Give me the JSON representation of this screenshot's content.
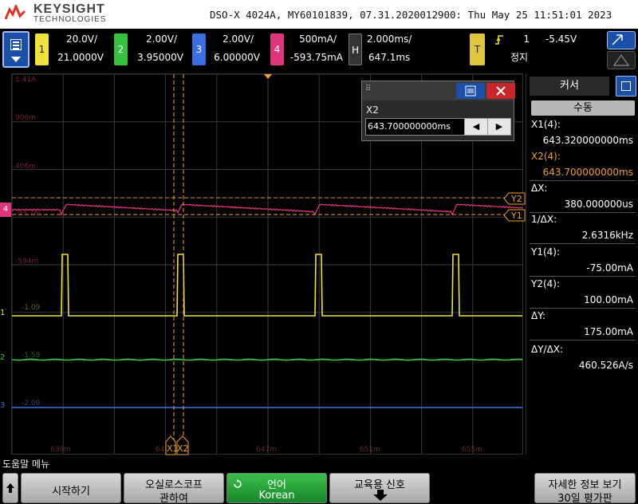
{
  "header": {
    "brand": "KEYSIGHT",
    "brand_sub": "TECHNOLOGIES",
    "title": "DSO-X 4024A, MY60101839, 07.31.2020012900: Thu May 25 11:51:01 2023"
  },
  "channels": [
    {
      "num": "1",
      "scale": "20.0V/",
      "offset": "21.0000V",
      "color": "#f0e23a"
    },
    {
      "num": "2",
      "scale": "2.00V/",
      "offset": "3.95000V",
      "color": "#36c43f"
    },
    {
      "num": "3",
      "scale": "2.00V/",
      "offset": "6.00000V",
      "color": "#3a6fe0"
    },
    {
      "num": "4",
      "scale": "500mA/",
      "offset": "-593.75mA",
      "color": "#e0357b"
    }
  ],
  "horizontal": {
    "tag": "H",
    "scale": "2.000ms/",
    "position": "647.1ms"
  },
  "trigger": {
    "tag": "T",
    "source": "1",
    "level": "-5.45V",
    "status": "정지"
  },
  "grid_labels": {
    "ch4_top": "1.41A",
    "ch4_1": "906m",
    "ch4_2": "406m",
    "ch4_3": "-93.7m",
    "ch4_4": "-594m",
    "ch1_1": "-1.09",
    "ch2_1": "-1.59",
    "ch3_1": "-2.09",
    "time_1": "639m",
    "time_2": "643m",
    "time_3": "647m",
    "time_4": "651m",
    "time_5": "655m"
  },
  "markers": {
    "x1": "X1",
    "x2": "X2",
    "y1": "Y1",
    "y2": "Y2",
    "ch4": "4",
    "ch1": "1",
    "ch2": "2",
    "ch3": "3"
  },
  "cursor_popup": {
    "label": "X2",
    "value": "643.700000000ms",
    "left_arrow": "◀",
    "right_arrow": "▶"
  },
  "cursor_panel": {
    "title": "커서",
    "mode": "수동",
    "rows": [
      {
        "label": "X1(4):",
        "value": "643.320000000ms",
        "color": "#ffffff"
      },
      {
        "label": "X2(4):",
        "value": "643.700000000ms",
        "color": "#f0a030"
      },
      {
        "label": "ΔX:",
        "value": "380.000000us",
        "color": "#ffffff"
      },
      {
        "label": "1/ΔX:",
        "value": "2.6316kHz",
        "color": "#ffffff"
      },
      {
        "label": "Y1(4):",
        "value": "-75.00mA",
        "color": "#ffffff"
      },
      {
        "label": "Y2(4):",
        "value": "100.00mA",
        "color": "#ffffff"
      },
      {
        "label": "ΔY:",
        "value": "175.00mA",
        "color": "#ffffff"
      },
      {
        "label": "ΔY/ΔX:",
        "value": "460.526A/s",
        "color": "#ffffff"
      }
    ]
  },
  "help": {
    "label": "도움말 메뉴"
  },
  "softkeys": [
    {
      "line1": "시작하기",
      "line2": ""
    },
    {
      "line1": "오실로스코프",
      "line2": "관하여"
    },
    {
      "line1": "언어",
      "line2": "Korean"
    },
    {
      "line1": "교육용 신호",
      "line2": ""
    },
    {
      "line1": "자세한 정보 보기",
      "line2": "30일 평가판"
    }
  ],
  "colors": {
    "accent_blue": "#1b4fa8",
    "cursor_orange": "#f0a030",
    "ch4": "#e0357b"
  }
}
